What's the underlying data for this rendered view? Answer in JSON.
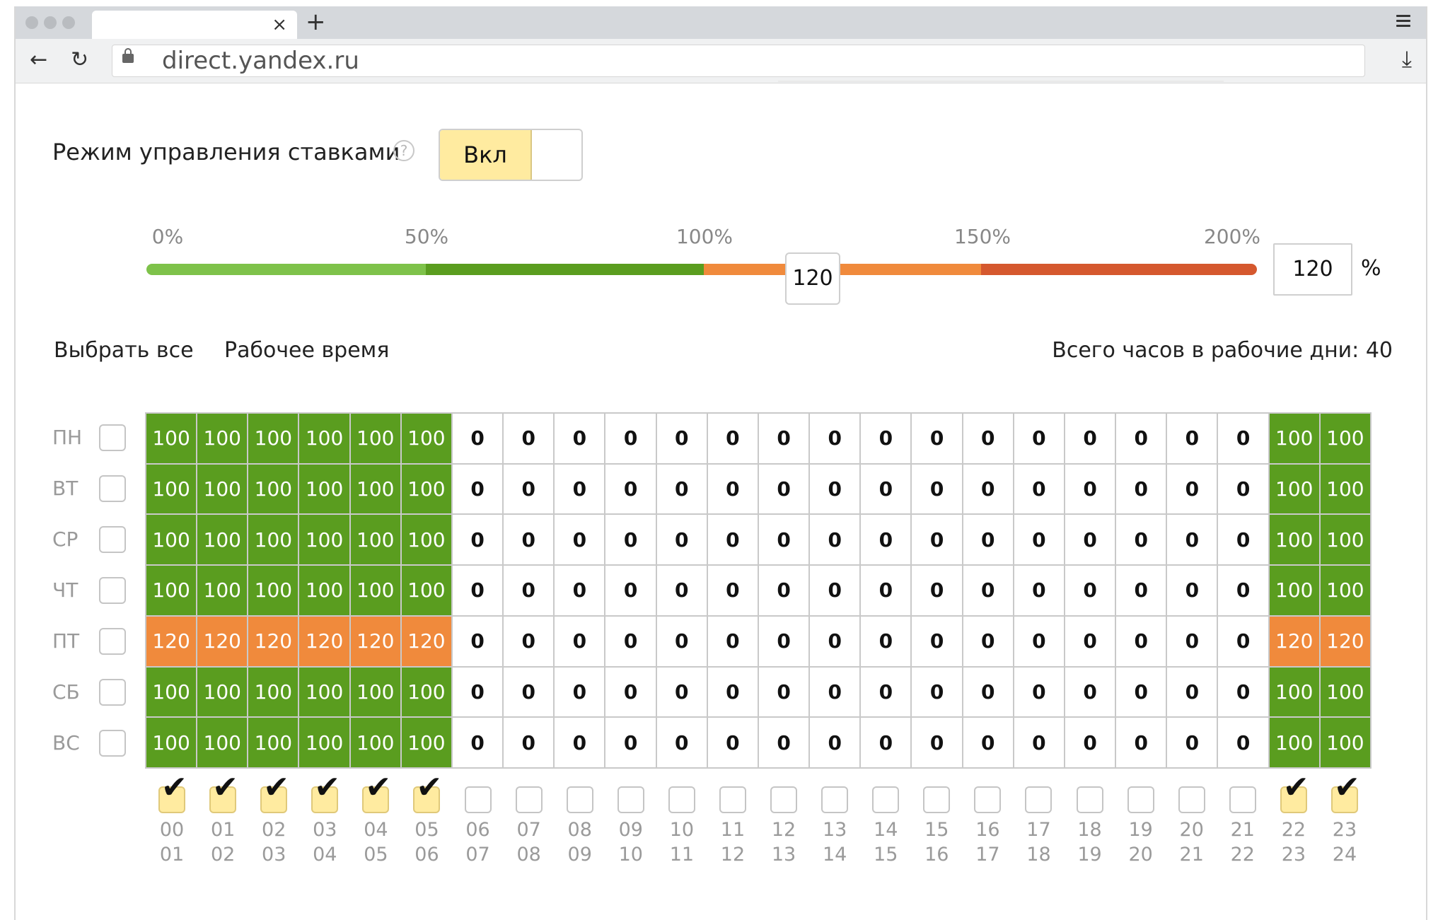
{
  "browser": {
    "tab_close": "×",
    "new_tab": "+",
    "back": "←",
    "reload": "↻",
    "url": "direct.yandex.ru",
    "download": "⤓"
  },
  "settings": {
    "mode_label": "Режим управления ставками",
    "help": "?",
    "toggle_on_label": "Вкл"
  },
  "slider": {
    "ticks": [
      "0%",
      "50%",
      "100%",
      "150%",
      "200%"
    ],
    "value": 120,
    "value_text": "120",
    "input_value": "120",
    "unit": "%",
    "min": 0,
    "max": 200
  },
  "actions": {
    "select_all": "Выбрать все",
    "work_time": "Рабочее время",
    "total_hours": "Всего часов в рабочие дни: 40"
  },
  "colors": {
    "green": "#5a9d1f",
    "light_green": "#7ec24a",
    "orange": "#f08a3c",
    "red": "#d5582e",
    "yellow": "#ffeba0"
  },
  "days": [
    "ПН",
    "ВТ",
    "СР",
    "ЧТ",
    "ПТ",
    "СБ",
    "ВС"
  ],
  "schedule": [
    [
      "100",
      "100",
      "100",
      "100",
      "100",
      "100",
      "0",
      "0",
      "0",
      "0",
      "0",
      "0",
      "0",
      "0",
      "0",
      "0",
      "0",
      "0",
      "0",
      "0",
      "0",
      "0",
      "100",
      "100"
    ],
    [
      "100",
      "100",
      "100",
      "100",
      "100",
      "100",
      "0",
      "0",
      "0",
      "0",
      "0",
      "0",
      "0",
      "0",
      "0",
      "0",
      "0",
      "0",
      "0",
      "0",
      "0",
      "0",
      "100",
      "100"
    ],
    [
      "100",
      "100",
      "100",
      "100",
      "100",
      "100",
      "0",
      "0",
      "0",
      "0",
      "0",
      "0",
      "0",
      "0",
      "0",
      "0",
      "0",
      "0",
      "0",
      "0",
      "0",
      "0",
      "100",
      "100"
    ],
    [
      "100",
      "100",
      "100",
      "100",
      "100",
      "100",
      "0",
      "0",
      "0",
      "0",
      "0",
      "0",
      "0",
      "0",
      "0",
      "0",
      "0",
      "0",
      "0",
      "0",
      "0",
      "0",
      "100",
      "100"
    ],
    [
      "120",
      "120",
      "120",
      "120",
      "120",
      "120",
      "0",
      "0",
      "0",
      "0",
      "0",
      "0",
      "0",
      "0",
      "0",
      "0",
      "0",
      "0",
      "0",
      "0",
      "0",
      "0",
      "120",
      "120"
    ],
    [
      "100",
      "100",
      "100",
      "100",
      "100",
      "100",
      "0",
      "0",
      "0",
      "0",
      "0",
      "0",
      "0",
      "0",
      "0",
      "0",
      "0",
      "0",
      "0",
      "0",
      "0",
      "0",
      "100",
      "100"
    ],
    [
      "100",
      "100",
      "100",
      "100",
      "100",
      "100",
      "0",
      "0",
      "0",
      "0",
      "0",
      "0",
      "0",
      "0",
      "0",
      "0",
      "0",
      "0",
      "0",
      "0",
      "0",
      "0",
      "100",
      "100"
    ]
  ],
  "hours": [
    {
      "from": "00",
      "to": "01",
      "checked": true
    },
    {
      "from": "01",
      "to": "02",
      "checked": true
    },
    {
      "from": "02",
      "to": "03",
      "checked": true
    },
    {
      "from": "03",
      "to": "04",
      "checked": true
    },
    {
      "from": "04",
      "to": "05",
      "checked": true
    },
    {
      "from": "05",
      "to": "06",
      "checked": true
    },
    {
      "from": "06",
      "to": "07",
      "checked": false
    },
    {
      "from": "07",
      "to": "08",
      "checked": false
    },
    {
      "from": "08",
      "to": "09",
      "checked": false
    },
    {
      "from": "09",
      "to": "10",
      "checked": false
    },
    {
      "from": "10",
      "to": "11",
      "checked": false
    },
    {
      "from": "11",
      "to": "12",
      "checked": false
    },
    {
      "from": "12",
      "to": "13",
      "checked": false
    },
    {
      "from": "13",
      "to": "14",
      "checked": false
    },
    {
      "from": "14",
      "to": "15",
      "checked": false
    },
    {
      "from": "15",
      "to": "16",
      "checked": false
    },
    {
      "from": "16",
      "to": "17",
      "checked": false
    },
    {
      "from": "17",
      "to": "18",
      "checked": false
    },
    {
      "from": "18",
      "to": "19",
      "checked": false
    },
    {
      "from": "19",
      "to": "20",
      "checked": false
    },
    {
      "from": "20",
      "to": "21",
      "checked": false
    },
    {
      "from": "21",
      "to": "22",
      "checked": false
    },
    {
      "from": "22",
      "to": "23",
      "checked": true
    },
    {
      "from": "23",
      "to": "24",
      "checked": true
    }
  ]
}
